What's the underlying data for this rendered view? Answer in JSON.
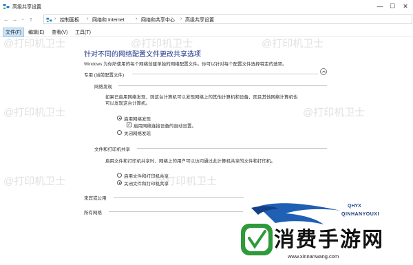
{
  "window": {
    "title": "高级共享设置"
  },
  "window_controls": {
    "minimize": "—",
    "maximize": "☐",
    "close": "✕"
  },
  "address": {
    "crumbs": [
      "控制面板",
      "网络和 Internet",
      "网络和共享中心",
      "高级共享设置"
    ],
    "separator": "›"
  },
  "menu": {
    "items": [
      "文件(F)",
      "编辑(E)",
      "查看(V)",
      "工具(T)"
    ]
  },
  "main": {
    "heading": "针对不同的网络配置文件更改共享选项",
    "description": "Windows 为你所使用的每个网络创建单独的网络配置文件。你可以针对每个配置文件选择特定的选项。",
    "private": {
      "label": "专用 (当前配置文件)",
      "discovery": {
        "title": "网络发现",
        "text1": "如果已启用网络发现，则这台计算机可以发现网络上的其他计算机和设备，而且其他网络计算机也",
        "text2": "可以发现这台计算机。",
        "opt_on": "启用网络发现",
        "opt_auto": "启用网络连接设备的自动设置。",
        "opt_off": "关闭网络发现"
      },
      "sharing": {
        "title": "文件和打印机共享",
        "text": "启用文件和打印机共享时，网络上的用户可以访问通过此计算机共享的文件和打印机。",
        "opt_on": "启用文件和打印机共享",
        "opt_off": "关闭文件和打印机共享"
      }
    },
    "guest": {
      "label": "来宾或公用"
    },
    "all": {
      "label": "所有网络"
    }
  },
  "watermark": {
    "text": "@打印机卫士"
  },
  "logo": {
    "brand": "QHYX",
    "brand_en": "QINHANYOUXI",
    "name": "消费手游网",
    "url": "www.xinnanwang.com"
  },
  "colors": {
    "heading": "#1e3287",
    "menu_active": "#cce4f7",
    "logo_green": "#2e9a3a",
    "logo_blue": "#1f4fa0"
  }
}
